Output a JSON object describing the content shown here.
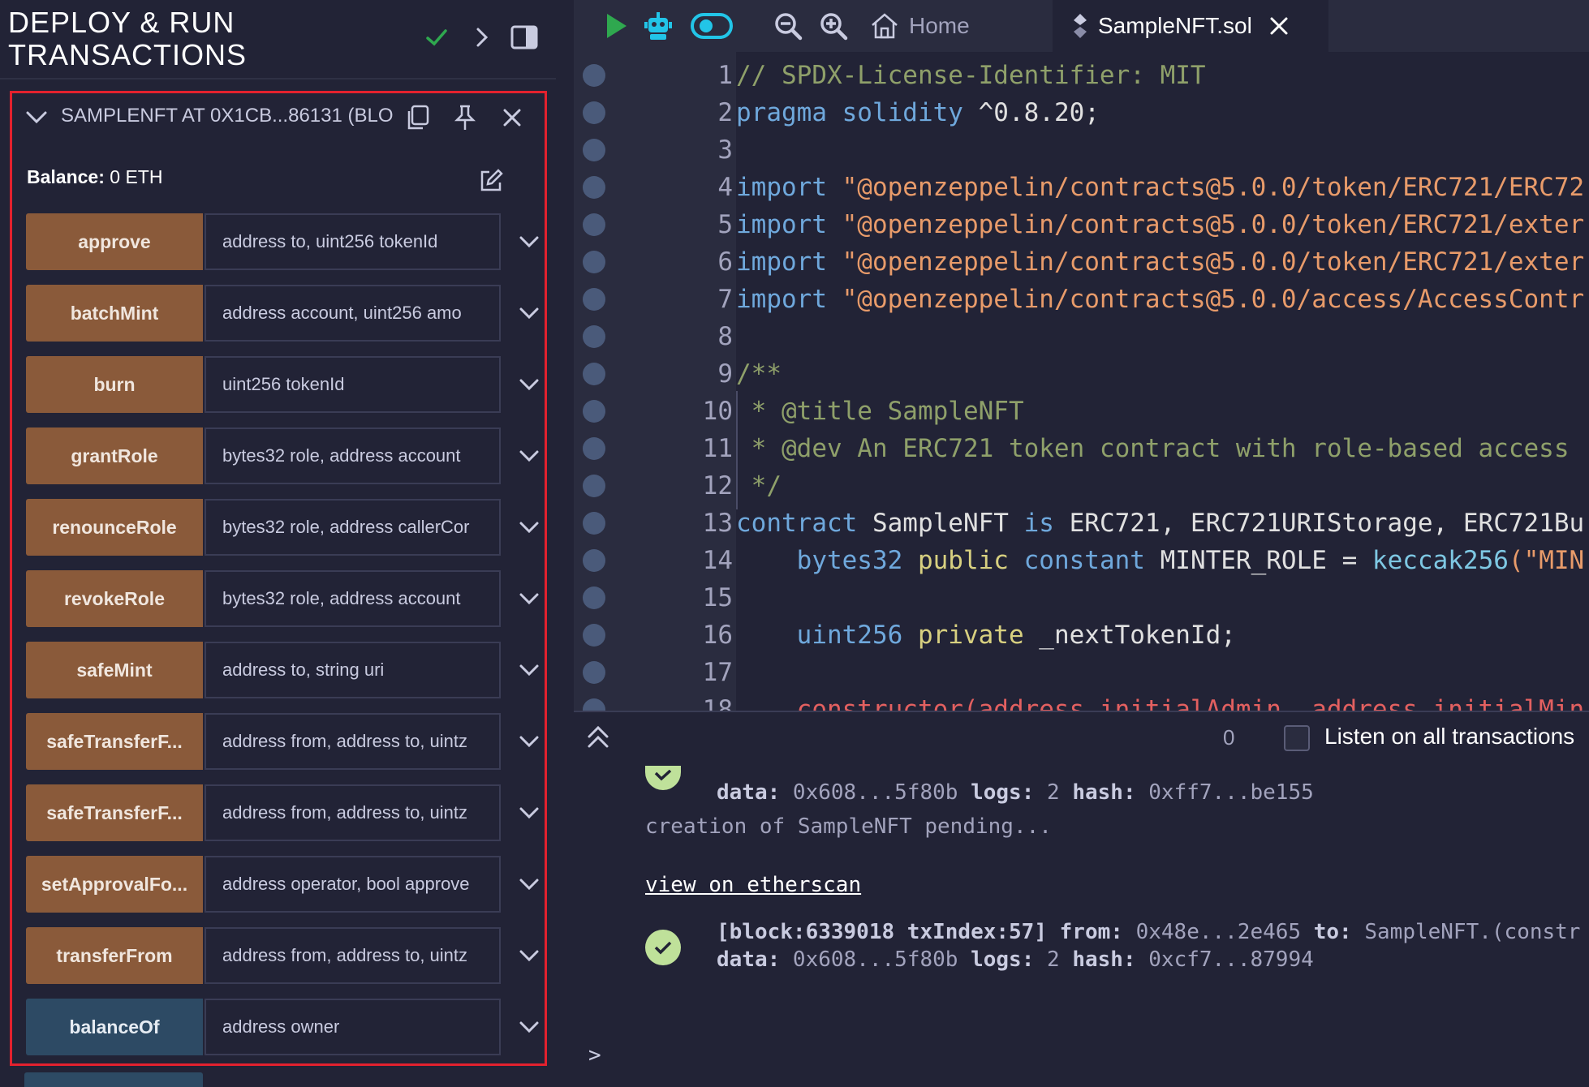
{
  "panel": {
    "title": "DEPLOY & RUN TRANSACTIONS",
    "instance_label": "SAMPLENFT AT 0X1CB...86131 (BLO",
    "balance_label": "Balance:",
    "balance_value": "0 ETH"
  },
  "functions": [
    {
      "name": "approve",
      "params": "address to, uint256 tokenId",
      "kind": "transact"
    },
    {
      "name": "batchMint",
      "params": "address account, uint256 amo",
      "kind": "transact"
    },
    {
      "name": "burn",
      "params": "uint256 tokenId",
      "kind": "transact"
    },
    {
      "name": "grantRole",
      "params": "bytes32 role, address account",
      "kind": "transact"
    },
    {
      "name": "renounceRole",
      "params": "bytes32 role, address callerCor",
      "kind": "transact"
    },
    {
      "name": "revokeRole",
      "params": "bytes32 role, address account",
      "kind": "transact"
    },
    {
      "name": "safeMint",
      "params": "address to, string uri",
      "kind": "transact"
    },
    {
      "name": "safeTransferF...",
      "params": "address from, address to, uintz",
      "kind": "transact"
    },
    {
      "name": "safeTransferF...",
      "params": "address from, address to, uintz",
      "kind": "transact"
    },
    {
      "name": "setApprovalFo...",
      "params": "address operator, bool approve",
      "kind": "transact"
    },
    {
      "name": "transferFrom",
      "params": "address from, address to, uintz",
      "kind": "transact"
    },
    {
      "name": "balanceOf",
      "params": "address owner",
      "kind": "call"
    }
  ],
  "topbar": {
    "home_label": "Home",
    "file_tab_label": "SampleNFT.sol"
  },
  "editor": {
    "line_numbers": [
      "1",
      "2",
      "3",
      "4",
      "5",
      "6",
      "7",
      "8",
      "9",
      "10",
      "11",
      "12",
      "13",
      "14",
      "15",
      "16",
      "17",
      "18"
    ],
    "lines": {
      "l1": "// SPDX-License-Identifier: MIT",
      "l2a": "pragma solidity",
      "l2b": " ^0.8.20;",
      "l4a": "import",
      "l4b": " \"@openzeppelin/contracts@5.0.0/token/ERC721/ERC72",
      "l5a": "import",
      "l5b": " \"@openzeppelin/contracts@5.0.0/token/ERC721/exter",
      "l6a": "import",
      "l6b": " \"@openzeppelin/contracts@5.0.0/token/ERC721/exter",
      "l7a": "import",
      "l7b": " \"@openzeppelin/contracts@5.0.0/access/AccessContr",
      "l9": "/**",
      "l10": " * @title SampleNFT",
      "l11": " * @dev An ERC721 token contract with role-based access",
      "l12": " */",
      "l13a": "contract",
      "l13b": " SampleNFT ",
      "l13c": "is",
      "l13d": " ERC721, ERC721URIStorage, ERC721Bu",
      "l14a": "    bytes32",
      "l14b": " public",
      "l14c": " constant",
      "l14d": " MINTER_ROLE = ",
      "l14e": "keccak256",
      "l14f": "(\"MIN",
      "l16a": "    uint256",
      "l16b": " private",
      "l16c": " _nextTokenId;",
      "l18": "    constructor(address initialAdmin, address initialMin"
    }
  },
  "terminal": {
    "count": "0",
    "listen_label": "Listen on all transactions",
    "entry1_line2": {
      "k1": "data:",
      "v1": " 0x608...5f80b ",
      "k2": "logs:",
      "v2": " 2 ",
      "k3": "hash:",
      "v3": " 0xff7...be155"
    },
    "pending_text": "creation of SampleNFT pending...",
    "etherscan_link": "view on etherscan",
    "entry2_line1": {
      "block": "[block:6339018 txIndex:57]",
      "k1": " from:",
      "v1": " 0x48e...2e465 ",
      "k2": "to:",
      "v2": " SampleNFT.(constr"
    },
    "entry2_line2": {
      "k1": "data:",
      "v1": " 0x608...5f80b ",
      "k2": "logs:",
      "v2": " 2 ",
      "k3": "hash:",
      "v3": " 0xcf7...87994"
    },
    "prompt": ">"
  },
  "colors": {
    "accent_transact": "#8a5a3a",
    "accent_call": "#2d4a64",
    "highlight_border": "#e3212e",
    "success": "#bfe19a",
    "run_green": "#2fa84f",
    "toggle_cyan": "#22c5e8"
  }
}
